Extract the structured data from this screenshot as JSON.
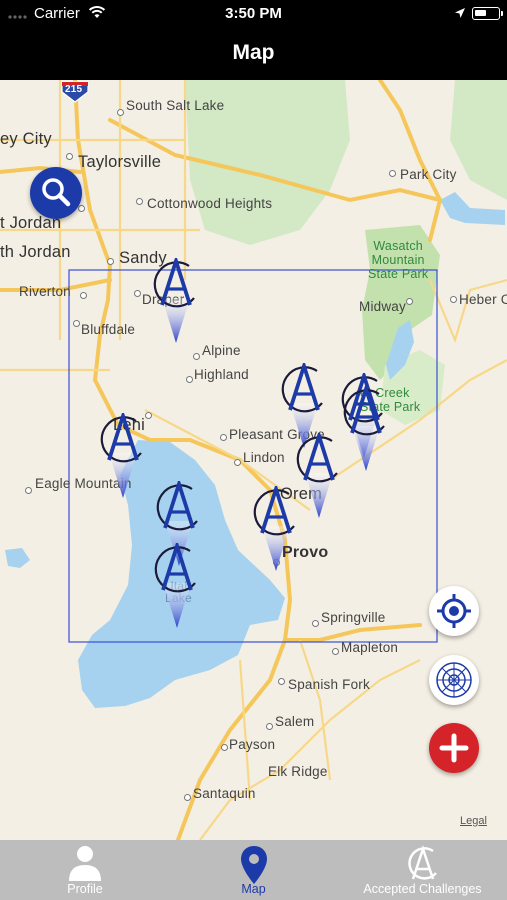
{
  "status_bar": {
    "carrier": "Carrier",
    "time": "3:50 PM"
  },
  "nav": {
    "title": "Map"
  },
  "map": {
    "labels": {
      "south_salt_lake": "South Salt Lake",
      "west_valley_city": "ey City",
      "taylorsville": "Taylorsville",
      "cottonwood_heights": "Cottonwood Heights",
      "park_city": "Park City",
      "west_jordan": "t Jordan",
      "south_jordan": "th Jordan",
      "sandy": "Sandy",
      "wasatch_park": "Wasatch\nMountain\nState Park",
      "riverton": "Riverton",
      "draper": "Draper",
      "midway": "Midway",
      "heber": "Heber C",
      "bluffdale": "Bluffdale",
      "alpine": "Alpine",
      "highland": "Highland",
      "deer_creek": "er Creek\nState Park",
      "lehi": "Lehi",
      "pleasant_grove": "Pleasant Grove",
      "lindon": "Lindon",
      "eagle_mountain": "Eagle Mountain",
      "orem": "Orem",
      "provo": "Provo",
      "utah_lake": "Utah\nLake",
      "springville": "Springville",
      "mapleton": "Mapleton",
      "spanish_fork": "Spanish Fork",
      "salem": "Salem",
      "payson": "Payson",
      "elk_ridge": "Elk Ridge",
      "santaquin": "Santaquin",
      "highway_215": "215"
    },
    "legal": "Legal",
    "marker_icon": "challenge-a-pin-icon"
  },
  "colors": {
    "accent": "#1c3aa8",
    "add": "#d42329",
    "tabbar": "#bdbdbd",
    "water": "#a6d2f0",
    "park": "#c7e3b4",
    "road": "#f5c65a"
  },
  "tabs": [
    {
      "label": "Profile",
      "icon": "person-icon"
    },
    {
      "label": "Map",
      "icon": "map-pin-icon"
    },
    {
      "label": "Accepted Challenges",
      "icon": "challenge-logo-icon"
    }
  ]
}
